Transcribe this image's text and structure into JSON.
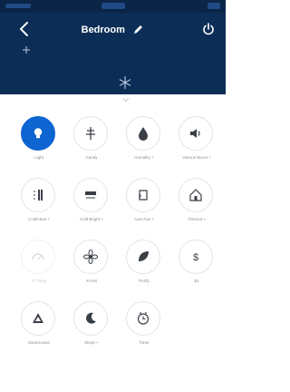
{
  "header": {
    "title": "Bedroom",
    "colors": {
      "background": "#0c2d56",
      "accent": "#0e64d0"
    },
    "icons": {
      "back": "chevron-left-icon",
      "edit": "pencil-icon",
      "power": "power-icon",
      "add": "plus-icon",
      "center": "snowflake-icon"
    }
  },
  "tiles": [
    {
      "id": "light",
      "label": "Light",
      "icon": "bulb-icon",
      "active": true
    },
    {
      "id": "candy",
      "label": "Candy",
      "icon": "tree-icon"
    },
    {
      "id": "humidity",
      "label": "Humidity +",
      "icon": "drop-icon"
    },
    {
      "id": "volume",
      "label": "Volume Boost +",
      "icon": "speaker-icon"
    },
    {
      "id": "coldheat",
      "label": "Cold/Heat +",
      "icon": "bars-icon"
    },
    {
      "id": "coldbright",
      "label": "Cold Bright +",
      "icon": "panel-icon"
    },
    {
      "id": "auto-fan",
      "label": "Auto Fan +",
      "icon": "square-curl-icon"
    },
    {
      "id": "timeout",
      "label": "Timeout +",
      "icon": "house-icon"
    },
    {
      "id": "temp",
      "label": "17 Temp",
      "icon": "gauge-icon",
      "faded": true
    },
    {
      "id": "x-fan",
      "label": "X-Fan",
      "icon": "fan-icon"
    },
    {
      "id": "purify",
      "label": "Purify",
      "icon": "leaf-icon"
    },
    {
      "id": "ble",
      "label": "$4",
      "icon": "dollar-icon"
    },
    {
      "id": "save-leave",
      "label": "Save/Leave",
      "icon": "recycle-icon"
    },
    {
      "id": "sleep",
      "label": "Sleep +",
      "icon": "moon-icon"
    },
    {
      "id": "timer",
      "label": "Timer",
      "icon": "clock-icon"
    }
  ]
}
